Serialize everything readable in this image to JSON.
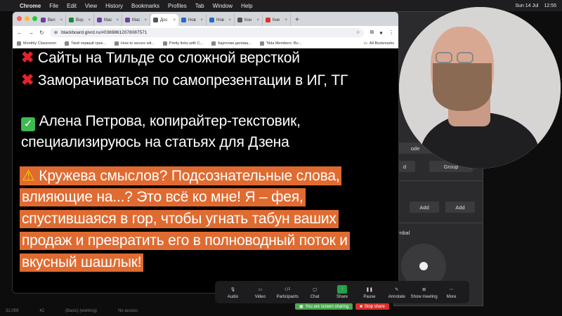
{
  "menubar": {
    "app": "Chrome",
    "items": [
      "File",
      "Edit",
      "View",
      "History",
      "Bookmarks",
      "Profiles",
      "Tab",
      "Window",
      "Help"
    ],
    "date": "Sun 14 Jul",
    "time": "12:55"
  },
  "browser": {
    "tabs": [
      {
        "label": "Вел",
        "color": "#6b3fa0"
      },
      {
        "label": "Вор",
        "color": "#1a8a3a"
      },
      {
        "label": "Мас",
        "color": "#6b3fa0"
      },
      {
        "label": "Мас",
        "color": "#6b3fa0"
      },
      {
        "label": "Дос",
        "color": "#555555",
        "active": true
      },
      {
        "label": "Нов",
        "color": "#2a66c8"
      },
      {
        "label": "Нов",
        "color": "#2a66c8"
      },
      {
        "label": "Кон",
        "color": "#555555"
      },
      {
        "label": "Кни",
        "color": "#d9302c"
      }
    ],
    "url": "blackboard.glvrd.ru/#03698612078087571",
    "bookmarks": [
      "Monthly Classroom",
      "Твой первый трек...",
      "How to secure wit...",
      "Pretty links with C...",
      "Карточки делова...",
      "Tilda Members: Bo..."
    ],
    "all_bookmarks": "All Bookmarks"
  },
  "slide": {
    "line1": "Сайты на Тильде со сложной версткой",
    "line2": "Заморачиваться по самопрезентации в ИГ, ТГ",
    "line3": "Алена Петрова, копирайтер-текстовик,",
    "line4": "специализируюсь на статьях для Дзена",
    "hl1": "Кружева смыслов? Подсознательные слова,",
    "hl2": "влияющие на...? Это всё ко мне! Я – фея,",
    "hl3": "спустившаяся в гор, чтобы угнать табун ваших",
    "hl4": "продаж и превратить его в полноводный поток и",
    "hl5": "вкусный шашлык!"
  },
  "zoom_panel": {
    "mode": "ode",
    "d": "d",
    "group": "Group",
    "add1": "Add",
    "add2": "Add",
    "umbal": "mbal"
  },
  "zoom_toolbar": {
    "items": [
      {
        "label": "Audio",
        "icon": "microphone-icon"
      },
      {
        "label": "Video",
        "icon": "camera-icon"
      },
      {
        "label": "Participants",
        "icon": "participants-icon",
        "count": "1"
      },
      {
        "label": "Chat",
        "icon": "chat-icon"
      },
      {
        "label": "Share",
        "icon": "share-screen-icon"
      },
      {
        "label": "Pause",
        "icon": "pause-icon"
      },
      {
        "label": "Annotate",
        "icon": "pen-icon"
      },
      {
        "label": "Show meeting",
        "icon": "meeting-grid-icon"
      },
      {
        "label": "More",
        "icon": "more-icon"
      }
    ],
    "sharing_status": "You are screen sharing",
    "stop_share": "Stop share"
  },
  "statusbar": {
    "left": "32,059",
    "mid": "42",
    "basic": "(Basic) (working)",
    "noaccess": "No access"
  }
}
